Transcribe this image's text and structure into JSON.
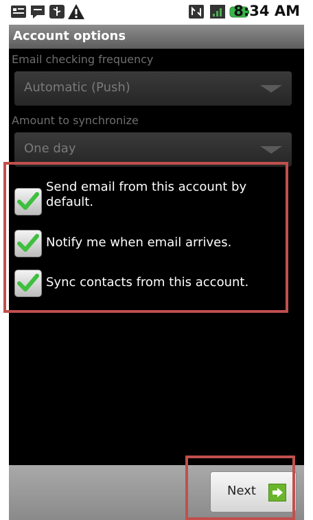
{
  "status_bar": {
    "time": "8:34 AM",
    "left_icons": [
      "notification-icon",
      "chat-icon",
      "usb-icon",
      "warning-icon"
    ],
    "right_icons": [
      "network-icon",
      "signal-icon",
      "battery-icon"
    ]
  },
  "header": {
    "title": "Account options"
  },
  "settings": {
    "frequency": {
      "label": "Email checking frequency",
      "value": "Automatic (Push)"
    },
    "sync_amount": {
      "label": "Amount to synchronize",
      "value": "One day"
    }
  },
  "options": [
    {
      "label": "Send email from this account by default.",
      "checked": true
    },
    {
      "label": "Notify me when email arrives.",
      "checked": true
    },
    {
      "label": "Sync contacts from this account.",
      "checked": true
    }
  ],
  "footer": {
    "next_label": "Next"
  },
  "colors": {
    "check_green": "#3fbf3f",
    "annotation_red": "#c0504d"
  }
}
